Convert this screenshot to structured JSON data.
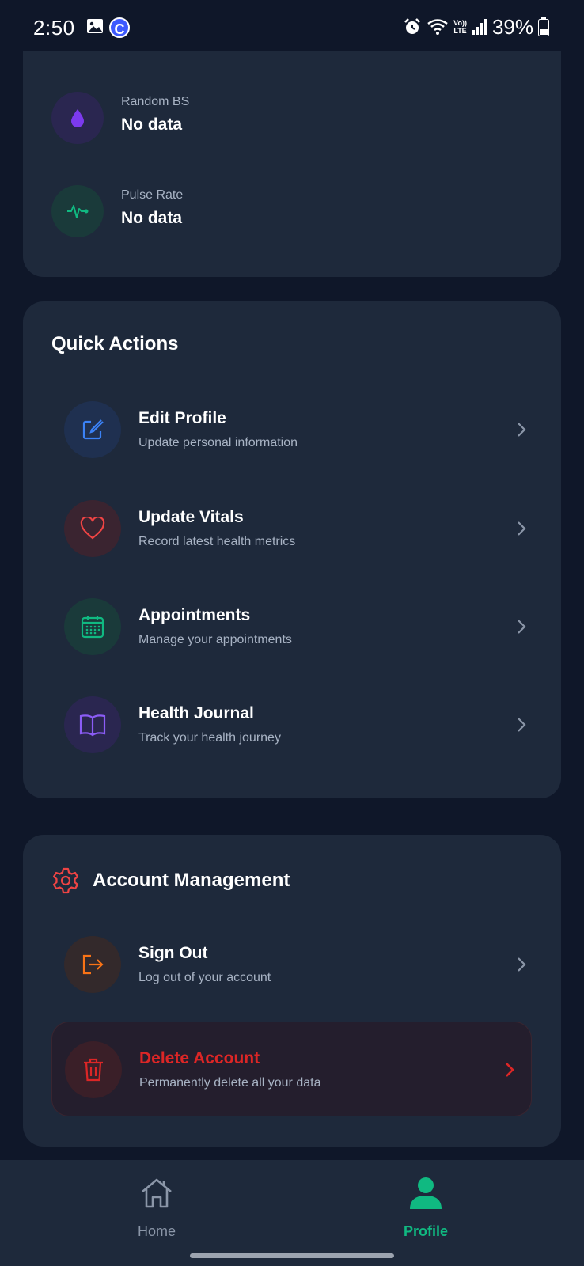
{
  "status_bar": {
    "time": "2:50",
    "battery": "39%",
    "volte_top": "Vo))",
    "volte_bottom": "LTE",
    "c_badge": "C"
  },
  "vitals": {
    "items": [
      {
        "label": "Random BS",
        "value": "No data",
        "icon": "water-drop-icon",
        "color": "#7c3aed"
      },
      {
        "label": "Pulse Rate",
        "value": "No data",
        "icon": "pulse-icon",
        "color": "#10b981"
      }
    ]
  },
  "quick_actions": {
    "title": "Quick Actions",
    "items": [
      {
        "title": "Edit Profile",
        "subtitle": "Update personal information",
        "icon": "edit-icon",
        "color": "#3b82f6"
      },
      {
        "title": "Update Vitals",
        "subtitle": "Record latest health metrics",
        "icon": "heart-icon",
        "color": "#ef4444"
      },
      {
        "title": "Appointments",
        "subtitle": "Manage your appointments",
        "icon": "calendar-icon",
        "color": "#10b981"
      },
      {
        "title": "Health Journal",
        "subtitle": "Track your health journey",
        "icon": "book-icon",
        "color": "#8b5cf6"
      }
    ]
  },
  "account": {
    "title": "Account Management",
    "sign_out": {
      "title": "Sign Out",
      "subtitle": "Log out of your account",
      "icon": "sign-out-icon",
      "color": "#f97316"
    },
    "delete": {
      "title": "Delete Account",
      "subtitle": "Permanently delete all your data",
      "icon": "trash-icon",
      "color": "#dc2626"
    }
  },
  "bottom_nav": {
    "home": "Home",
    "profile": "Profile",
    "active": "profile",
    "accent": "#10b981"
  }
}
